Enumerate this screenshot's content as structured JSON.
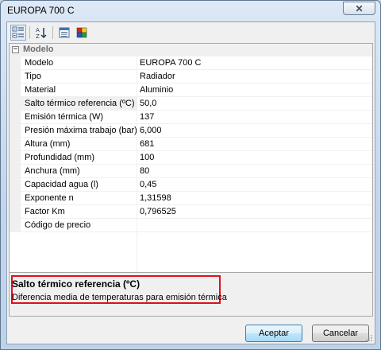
{
  "window": {
    "title": "EUROPA 700 C"
  },
  "toolbar": {
    "buttons": [
      {
        "name": "categorized-icon",
        "active": true
      },
      {
        "name": "alphabetical-icon",
        "active": false
      },
      {
        "name": "property-pages-icon",
        "active": false
      },
      {
        "name": "color-palette-icon",
        "active": false
      }
    ]
  },
  "grid": {
    "category": "Modelo",
    "collapse_glyph": "⊟",
    "properties": [
      {
        "name": "Modelo",
        "value": "EUROPA 700 C"
      },
      {
        "name": "Tipo",
        "value": "Radiador"
      },
      {
        "name": "Material",
        "value": "Aluminio"
      },
      {
        "name": "Salto térmico referencia (ºC)",
        "value": "50,0"
      },
      {
        "name": "Emisión térmica (W)",
        "value": "137"
      },
      {
        "name": "Presión máxima trabajo (bar)",
        "value": "6,000"
      },
      {
        "name": "Altura (mm)",
        "value": "681"
      },
      {
        "name": "Profundidad (mm)",
        "value": "100"
      },
      {
        "name": "Anchura (mm)",
        "value": "80"
      },
      {
        "name": "Capacidad agua (l)",
        "value": "0,45"
      },
      {
        "name": "Exponente n",
        "value": "1,31598"
      },
      {
        "name": "Factor Km",
        "value": "0,796525"
      },
      {
        "name": "Código de precio",
        "value": ""
      }
    ]
  },
  "help": {
    "title": "Salto térmico referencia (ºC)",
    "description": "Diferencia media de temperaturas para emisión térmica"
  },
  "buttons": {
    "accept": "Aceptar",
    "cancel": "Cancelar"
  },
  "colors": {
    "highlight": "#e0101c",
    "default_button_border": "#3c7fb1"
  }
}
